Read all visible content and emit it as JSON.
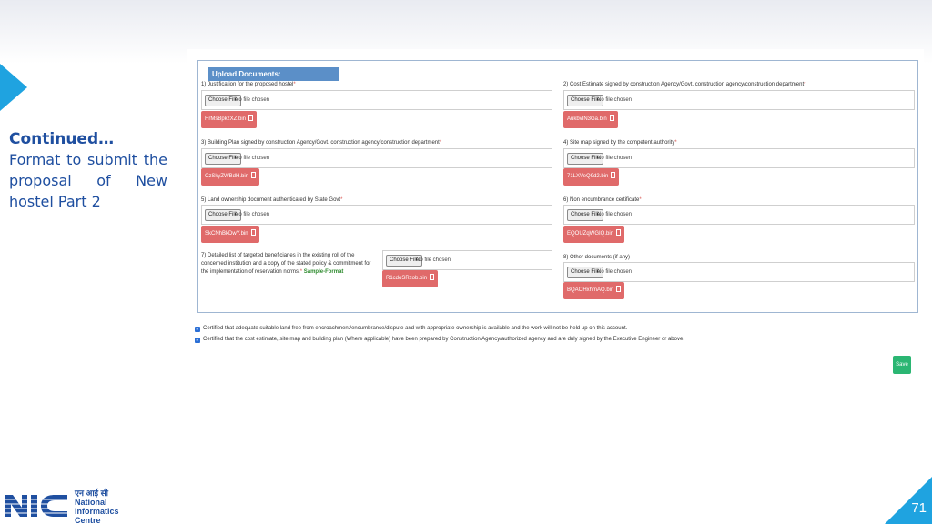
{
  "slide": {
    "caption_title": "Continued…",
    "caption_desc": "Format to submit the proposal of New hostel Part 2",
    "page_number": "71"
  },
  "form": {
    "legend": "Upload Documents:",
    "choose_label": "Choose File",
    "no_file_label": "No file chosen",
    "fields": [
      {
        "label": "1) Justification for the proposed hostel",
        "file": "HrMsBpkzXZ.bin"
      },
      {
        "label": "2) Cost Estimate signed by construction Agency/Govt. construction agency/construction department",
        "file": "AukbvIN3Ga.bin"
      },
      {
        "label": "3) Building Plan signed by construction Agency/Govt. construction agency/construction department",
        "file": "CzSkyZWBdH.bin"
      },
      {
        "label": "4) Site map signed by the competent authority",
        "file": "71LXVeQ9d2.bin"
      },
      {
        "label": "5) Land ownership document authenticated by State Govt",
        "file": "SkCNhBkDwY.bin"
      },
      {
        "label": "6) Non encumbrance certificate",
        "file": "EQOUZqWGIQ.bin"
      },
      {
        "label": "7) Detailed list of targeted beneficiaries in the existing roll of the concerned institution and a copy of the stated policy & commitment for the implementation of reservation norms.",
        "sample": "Sample-Format",
        "file": "R1cdoSRzob.bin"
      },
      {
        "label": "8) Other documents (if any)",
        "file": "BQAOHxhmAQ.bin"
      }
    ],
    "required_mark": "*",
    "certs": [
      "Certified that adequate suitable land free from encroachment/encumbrance/dispute and with appropriate ownership is available and the work will not be held up on this account.",
      "Certified that the cost estimate, site map and building plan (Where applicable) have been prepared by Construction Agency/authorized agency and are duly signed by the Executive Engineer or above."
    ],
    "save_label": "Save"
  },
  "logo": {
    "hindi": "एन आई सी",
    "line1": "National",
    "line2": "Informatics",
    "line3": "Centre"
  },
  "colors": {
    "accent_blue": "#1fa3e0",
    "title_blue": "#1f4fa0",
    "chip_red": "#e06a6a",
    "save_green": "#2bb673"
  }
}
